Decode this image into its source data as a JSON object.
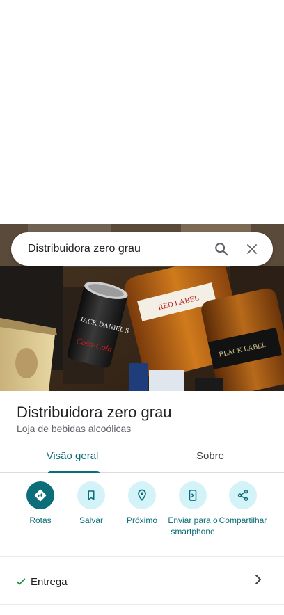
{
  "search": {
    "query": "Distribuidora zero grau",
    "search_icon": "search-icon",
    "close_icon": "close-icon"
  },
  "photo": {
    "can_text_1": "JACK DANIEL'S",
    "can_text_2": "Coca-Cola",
    "bottle_label_1": "RED LABEL",
    "bottle_label_2": "BLACK LABEL"
  },
  "place": {
    "name": "Distribuidora zero grau",
    "category": "Loja de bebidas alcoólicas"
  },
  "tabs": [
    {
      "label": "Visão geral",
      "active": true
    },
    {
      "label": "Sobre",
      "active": false
    }
  ],
  "actions": [
    {
      "label": "Rotas",
      "icon": "directions-icon"
    },
    {
      "label": "Salvar",
      "icon": "bookmark-icon"
    },
    {
      "label": "Próximo",
      "icon": "nearby-icon"
    },
    {
      "label": "Enviar para o smartphone",
      "icon": "send-to-phone-icon"
    },
    {
      "label": "Compartilhar",
      "icon": "share-icon"
    }
  ],
  "delivery": {
    "label": "Entrega",
    "status_icon": "check-icon",
    "chevron_icon": "chevron-right-icon"
  },
  "colors": {
    "accent": "#0b6e79",
    "accent_light": "#d3f3f8",
    "check": "#1e8e3e"
  }
}
